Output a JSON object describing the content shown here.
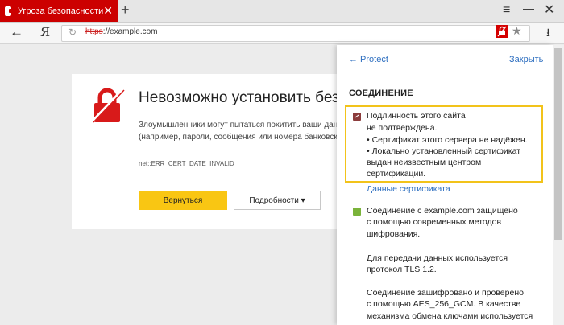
{
  "tab": {
    "title": "Угроза безопасности",
    "close": "✕",
    "new_tab": "+"
  },
  "window": {
    "menu": "≡",
    "minimize": "—",
    "close": "✕"
  },
  "toolbar": {
    "back": "←",
    "yandex": "Я",
    "reload": "↻",
    "url_protocol": "https",
    "url_rest": "://example.com",
    "star": "★",
    "download": "⭳"
  },
  "error_page": {
    "title": "Невозможно установить безопасное соединение",
    "description_line1": "Злоумышленники могут пытаться похитить ваши данные с сайта",
    "description_line2": "(например, пароли, сообщения или номера банковских карт).",
    "code": "net::ERR_CERT_DATE_INVALID",
    "back_button": "Вернуться",
    "details_button": "Подробности ▾"
  },
  "panel": {
    "back_link": "← Protect",
    "close_link": "Закрыть",
    "section_title": "СОЕДИНЕНИЕ",
    "warning_lines": [
      "Подлинность этого сайта",
      "не подтверждена.",
      "• Сертификат этого сервера не надёжен.",
      "• Локально установленный сертификат",
      "выдан неизвестным центром",
      "сертификации."
    ],
    "cert_link": "Данные сертификата",
    "info_lines": [
      "Соединение с example.com защищено",
      "с помощью современных методов",
      "шифрования.",
      "",
      "Для передачи данных используется",
      "протокол TLS 1.2.",
      "",
      "Соединение зашифровано и проверено",
      "с помощью AES_256_GCM. В качестве",
      "механизма обмена ключами используется"
    ]
  },
  "colors": {
    "tab_red": "#cc0000",
    "accent_yellow": "#f9c613",
    "link_blue": "#2e6fc0",
    "warning_border": "#f2c31a"
  }
}
